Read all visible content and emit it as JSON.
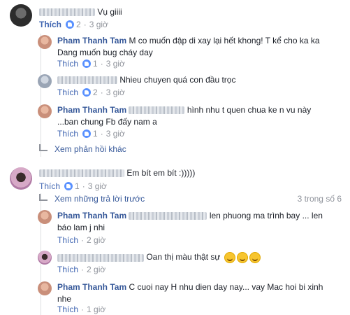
{
  "c1": {
    "text": "Vụ giiii",
    "like_label": "Thích",
    "likes": "2",
    "time": "3 giờ"
  },
  "r1": {
    "author": "Pham Thanh Tam",
    "line1": "M co muốn đập di xay lại hết khong! T kể cho ka ka",
    "line2": "Dang muốn bug cháy day",
    "like_label": "Thích",
    "likes": "1",
    "time": "3 giờ"
  },
  "r2": {
    "text": "Nhieu chuyen quá con đầu trọc",
    "like_label": "Thích",
    "likes": "2",
    "time": "3 giờ"
  },
  "r3": {
    "author": "Pham Thanh Tam",
    "line1": "hình nhu t quen chua ke n vu này",
    "line2": "...ban chung Fb đấy nam a",
    "like_label": "Thích",
    "likes": "1",
    "time": "3 giờ"
  },
  "more1": "Xem phản hồi khác",
  "c2": {
    "text": "Em bít em bít :)))))",
    "like_label": "Thích",
    "likes": "1",
    "time": "3 giờ"
  },
  "prev": {
    "label": "Xem những trả lời trước",
    "count": "3 trong số 6"
  },
  "r4": {
    "author": "Pham Thanh Tam",
    "line1": "len phuong ma trình bay ... len",
    "line2": "báo lam j nhi",
    "like_label": "Thích",
    "time": "2 giờ"
  },
  "r5": {
    "text": "Oan thị màu thật sự",
    "like_label": "Thích",
    "time": "2 giờ"
  },
  "r6": {
    "author": "Pham Thanh Tam",
    "line1": "C cuoi nay H nhu dien day nay... vay Mac hoi bi xinh",
    "line2": "nhe",
    "like_label": "Thích",
    "time": "1 giờ"
  },
  "colors": {
    "link": "#365899",
    "like": "#4267b2",
    "meta": "#90949c",
    "text": "#1d2129"
  }
}
